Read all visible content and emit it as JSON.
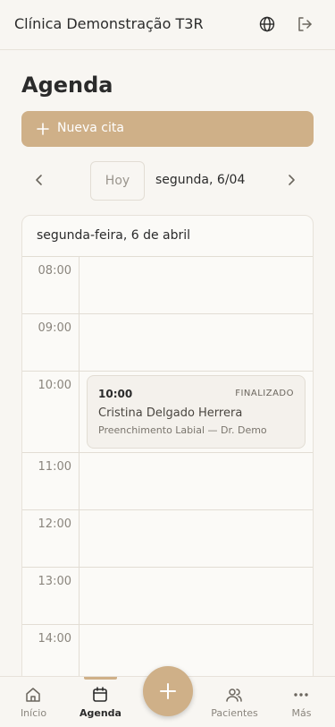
{
  "header": {
    "app_title": "Clínica Demonstração T3R",
    "language_icon": "globe-icon",
    "logout_icon": "logout-icon"
  },
  "page": {
    "title": "Agenda",
    "new_button_label": "Nueva cita"
  },
  "date_nav": {
    "today_label": "Hoy",
    "current_date": "segunda, 6/04"
  },
  "calendar": {
    "day_header": "segunda-feira, 6 de abril",
    "hours": [
      "08:00",
      "09:00",
      "10:00",
      "11:00",
      "12:00",
      "13:00",
      "14:00"
    ],
    "appointment": {
      "time": "10:00",
      "status": "FINALIZADO",
      "patient": "Cristina Delgado Herrera",
      "details": "Preenchimento Labial — Dr. Demo"
    }
  },
  "bottom_nav": {
    "items": [
      {
        "label": "Início",
        "icon": "home-icon"
      },
      {
        "label": "Agenda",
        "icon": "calendar-icon"
      },
      {
        "label": "Pacientes",
        "icon": "users-icon"
      },
      {
        "label": "Más",
        "icon": "more-icon"
      }
    ]
  },
  "colors": {
    "accent": "#cfb088",
    "background": "#f8f6f2",
    "border": "#e2ddd4"
  }
}
